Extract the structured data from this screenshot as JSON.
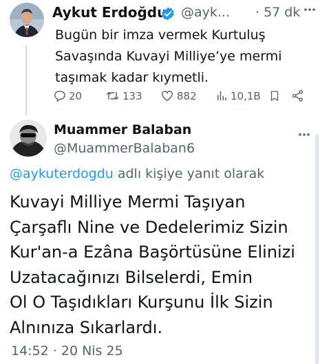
{
  "tweet": {
    "author_name": "Aykut Erdoğdu",
    "handle": "@ayk...",
    "time": "· 57 dk",
    "verified_color": "#1d9bf0",
    "text": "Bugün bir imza vermek Kurtuluş Savaşında Kuvayi Milliye’ye mermi taşımak kadar kıymetli.",
    "stats": {
      "replies": "20",
      "reposts": "133",
      "likes": "882",
      "views": "10,1B"
    }
  },
  "reply": {
    "author_name": "Muammer  Balaban",
    "handle": "@MuammerBalaban6",
    "replying_mention": "@aykuterdogdu",
    "replying_suffix": " adlı kişiye yanıt olarak",
    "text_lines": [
      "Kuvayi Milliye Mermi Taşıyan",
      "Çarşaflı Nine ve Dedelerimiz Sizin",
      "Kur'an-a Ezâna Başörtüsüne Elinizi",
      "Uzatacağınızı Bilselerdi, Emin",
      "Ol  O Taşıdıkları Kurşunu İlk Sizin",
      "Alnınıza Sıkarlardı."
    ],
    "timestamp": "14:52 · 20 Nis 25",
    "mention_color": "#1d9bf0"
  },
  "icons": [
    "verified-icon",
    "more-icon",
    "reply-icon",
    "repost-icon",
    "like-icon",
    "views-icon",
    "bookmark-icon",
    "share-icon"
  ]
}
